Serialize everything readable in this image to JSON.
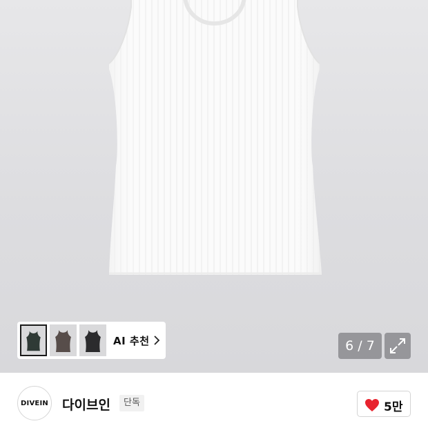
{
  "gallery": {
    "counter": "6 / 7",
    "expand_icon": "expand-arrows-icon"
  },
  "ai_recommend": {
    "label": "AI 추천",
    "thumbnails": [
      {
        "name": "dark-green tank top",
        "color": "#2f3a36"
      },
      {
        "name": "brown tank top",
        "color": "#574d4a"
      },
      {
        "name": "black tank top",
        "color": "#2b2b2d"
      }
    ],
    "chevron_icon": "chevron-right-icon"
  },
  "brand": {
    "logo_text": "DIVEIN",
    "name": "다이브인",
    "badge": "단독"
  },
  "like": {
    "count": "5만",
    "icon": "heart-icon",
    "color": "#e8232e"
  }
}
